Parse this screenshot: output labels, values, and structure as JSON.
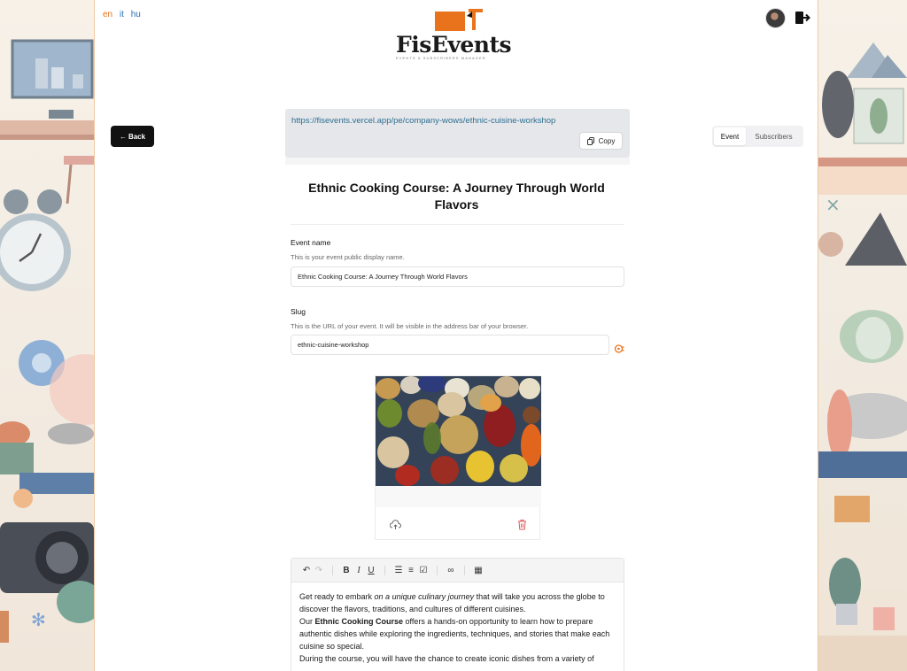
{
  "languages": [
    "en",
    "it",
    "hu"
  ],
  "active_language": "en",
  "brand": {
    "name": "FisEvents",
    "tagline": "EVENTS & SUBSCRIBERS MANAGER",
    "accent": "#e8731c"
  },
  "nav": {
    "back_label": "Back"
  },
  "share": {
    "url": "https://fisevents.vercel.app/pe/company-wows/ethnic-cuisine-workshop",
    "copy_label": "Copy"
  },
  "tabs": [
    {
      "label": "Event",
      "active": true
    },
    {
      "label": "Subscribers",
      "active": false
    }
  ],
  "event": {
    "title": "Ethnic Cooking Course: A Journey Through World Flavors",
    "name_label": "Event name",
    "name_desc": "This is your event public display name.",
    "name_value": "Ethnic Cooking Course: A Journey Through World Flavors",
    "slug_label": "Slug",
    "slug_desc": "This is the URL of your event. It will be visible in the address bar of your browser.",
    "slug_value": "ethnic-cuisine-workshop"
  },
  "editor": {
    "p1_a": "Get ready to embark ",
    "p1_em": "on a unique culinary journey",
    "p1_b": " that will take you across the globe to discover the flavors, traditions, and cultures of different cuisines.",
    "p2_a": "Our ",
    "p2_strong": "Ethnic Cooking Course",
    "p2_b": " offers a hands-on opportunity to learn how to prepare authentic dishes while exploring the ingredients, techniques, and stories that make each cuisine so special.",
    "p3": "During the course, you will have the chance to create iconic dishes from a variety of"
  }
}
